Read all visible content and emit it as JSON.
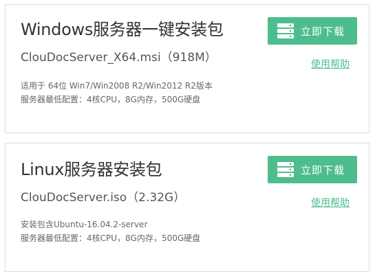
{
  "packages": [
    {
      "title": "Windows服务器一键安装包",
      "filename": "ClouDocServer_X64.msi（918M）",
      "desc_line1": "适用于 64位 Win7/Win2008 R2/Win2012 R2版本",
      "desc_line2": "服务器最低配置：4核CPU，8G内存，500G硬盘",
      "download_label": "立即下载",
      "help_label": "使用帮助"
    },
    {
      "title": "Linux服务器安装包",
      "filename": "ClouDocServer.iso（2.32G）",
      "desc_line1": "安装包含Ubuntu-16.04.2-server",
      "desc_line2": "服务器最低配置：4核CPU，8G内存，500G硬盘",
      "download_label": "立即下载",
      "help_label": "使用帮助"
    }
  ],
  "icons": {
    "download_button_icon": "server-icon"
  },
  "colors": {
    "accent": "#4ebd8e",
    "border": "#dcdcdc",
    "title_text": "#333333",
    "secondary_text": "#666666"
  }
}
